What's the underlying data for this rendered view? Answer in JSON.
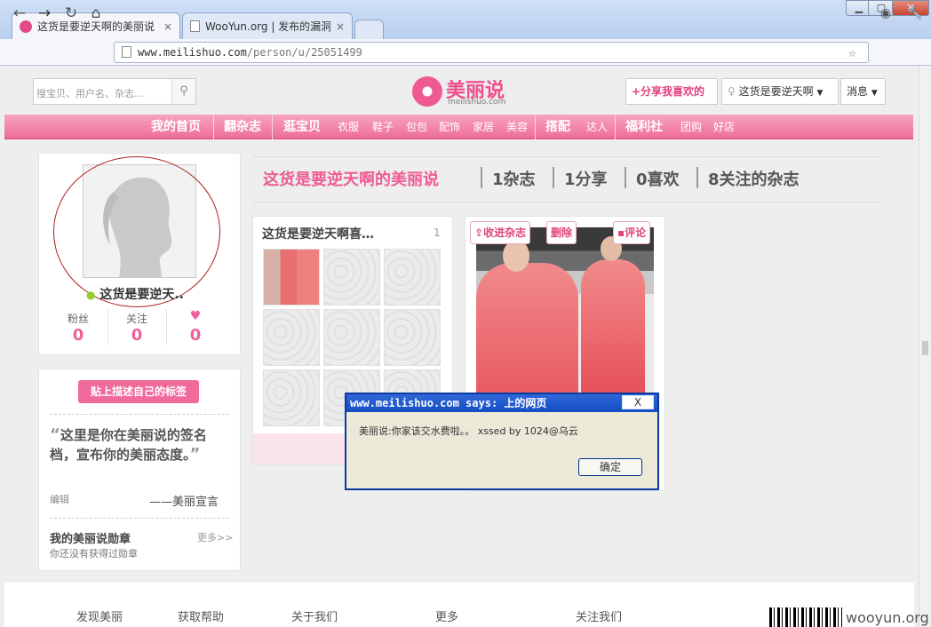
{
  "browser": {
    "tabs": [
      {
        "title": "这货是要逆天啊的美丽说 -",
        "close": "×"
      },
      {
        "title": "WooYun.org | 发布的漏洞",
        "close": "×"
      }
    ],
    "window_buttons": {
      "minimize": "▁",
      "maximize": "▢",
      "close": "✕"
    },
    "url": {
      "host": "www.meilishuo.com",
      "path": "/person/u/25051499"
    }
  },
  "header": {
    "search_placeholder": "搜宝贝、用户名、杂志…",
    "logo_text": "美丽说",
    "logo_sub": "meilishuo.com",
    "share_button": "+分享我喜欢的",
    "user_menu": "这货是要逆天啊",
    "messages_menu": "消息"
  },
  "nav": {
    "items": [
      {
        "label": "我的首页",
        "type": "main"
      },
      {
        "label": "翻杂志",
        "type": "main"
      },
      {
        "label": "逛宝贝",
        "type": "main"
      },
      {
        "label": "衣服",
        "type": "sub"
      },
      {
        "label": "鞋子",
        "type": "sub"
      },
      {
        "label": "包包",
        "type": "sub"
      },
      {
        "label": "配饰",
        "type": "sub"
      },
      {
        "label": "家居",
        "type": "sub"
      },
      {
        "label": "美容",
        "type": "sub"
      },
      {
        "label": "搭配",
        "type": "main"
      },
      {
        "label": "达人",
        "type": "sub"
      },
      {
        "label": "福利社",
        "type": "main"
      },
      {
        "label": "团购",
        "type": "sub"
      },
      {
        "label": "好店",
        "type": "sub"
      }
    ]
  },
  "profile": {
    "name": "这货是要逆天..",
    "stats": [
      {
        "label": "粉丝",
        "value": "0"
      },
      {
        "label": "关注",
        "value": "0"
      },
      {
        "label": "♥",
        "value": "0"
      }
    ]
  },
  "signature": {
    "tag_button": "贴上描述自己的标签",
    "text": "这里是你在美丽说的签名档，宣布你的美丽态度。",
    "open_quote": "“",
    "close_quote": "”",
    "edit": "编辑",
    "author": "——美丽宣言"
  },
  "badges": {
    "title": "我的美丽说勋章",
    "more": "更多>>",
    "empty": "你还没有获得过勋章"
  },
  "title_strip": {
    "name": "这货是要逆天啊的美丽说",
    "magazines": "1杂志",
    "shares": "1分享",
    "likes": "0喜欢",
    "followed": "8关注的杂志"
  },
  "magazine_card": {
    "title": "这货是要逆天啊喜…",
    "count": "1"
  },
  "photo_card": {
    "collect_button": "收进杂志",
    "delete_button": "删除",
    "comment_button": "评论"
  },
  "alert": {
    "title": "www.meilishuo.com says: 上的网页",
    "close": "X",
    "message": "美丽说:你家该交水费啦。。 xssed by 1024@乌云",
    "ok": "确定"
  },
  "footer": {
    "links": [
      "发现美丽",
      "获取帮助",
      "关于我们",
      "更多",
      "关注我们"
    ]
  },
  "watermark": "wooyun.org",
  "colors": {
    "brand": "#f0609a",
    "nav_pink": "#ee6e9c",
    "dialog_blue": "#124ec4"
  }
}
